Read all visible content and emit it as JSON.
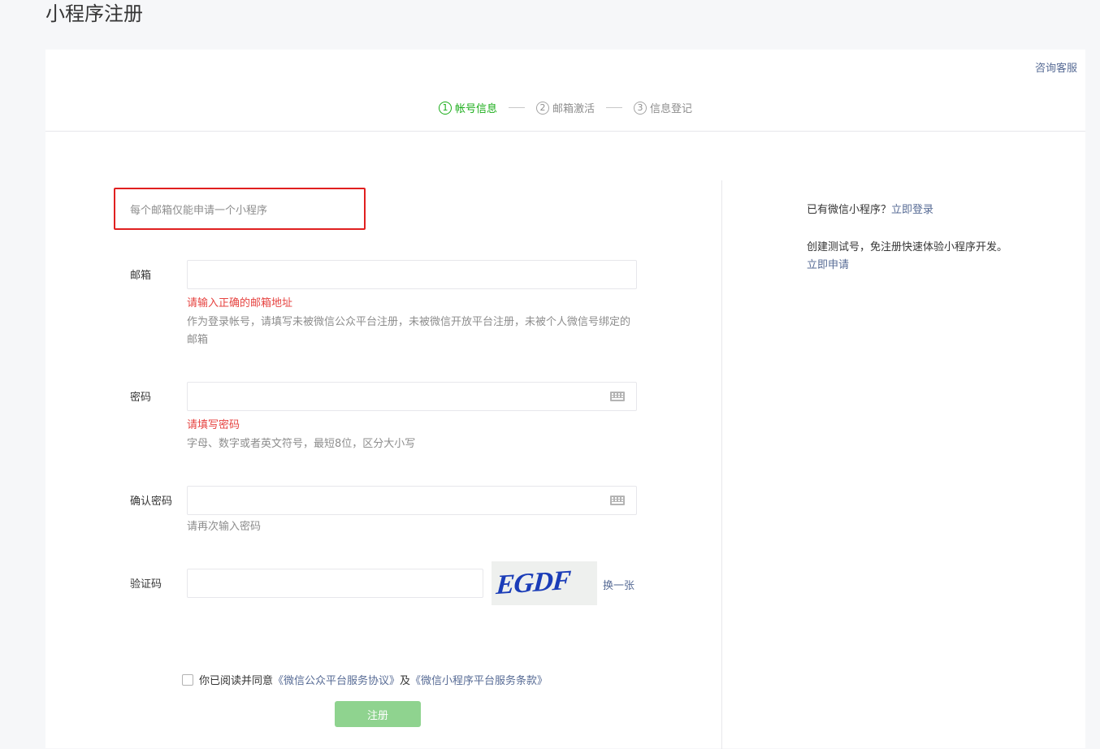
{
  "page": {
    "title": "小程序注册"
  },
  "header": {
    "service_link": "咨询客服"
  },
  "steps": [
    {
      "num": "1",
      "label": "帐号信息",
      "active": true
    },
    {
      "num": "2",
      "label": "邮箱激活",
      "active": false
    },
    {
      "num": "3",
      "label": "信息登记",
      "active": false
    }
  ],
  "notice": "每个邮箱仅能申请一个小程序",
  "form": {
    "email": {
      "label": "邮箱",
      "value": "",
      "error": "请输入正确的邮箱地址",
      "tip": "作为登录帐号，请填写未被微信公众平台注册，未被微信开放平台注册，未被个人微信号绑定的邮箱"
    },
    "password": {
      "label": "密码",
      "value": "",
      "error": "请填写密码",
      "tip": "字母、数字或者英文符号，最短8位，区分大小写"
    },
    "confirm": {
      "label": "确认密码",
      "value": "",
      "tip": "请再次输入密码"
    },
    "captcha": {
      "label": "验证码",
      "value": "",
      "image_text": "EGDF",
      "refresh": "换一张"
    },
    "agreement": {
      "prefix": "你已阅读并同意",
      "link1": "《微信公众平台服务协议》",
      "and": "及",
      "link2": "《微信小程序平台服务条款》",
      "checked": false
    },
    "submit": "注册"
  },
  "sidebar": {
    "login_prefix": "已有微信小程序？",
    "login_link": "立即登录",
    "test_text": "创建测试号，免注册快速体验小程序开发。",
    "test_link": "立即申请"
  },
  "colors": {
    "accent": "#1aad19",
    "link": "#576b95",
    "error": "#e64340",
    "notice_border": "#e02020"
  }
}
